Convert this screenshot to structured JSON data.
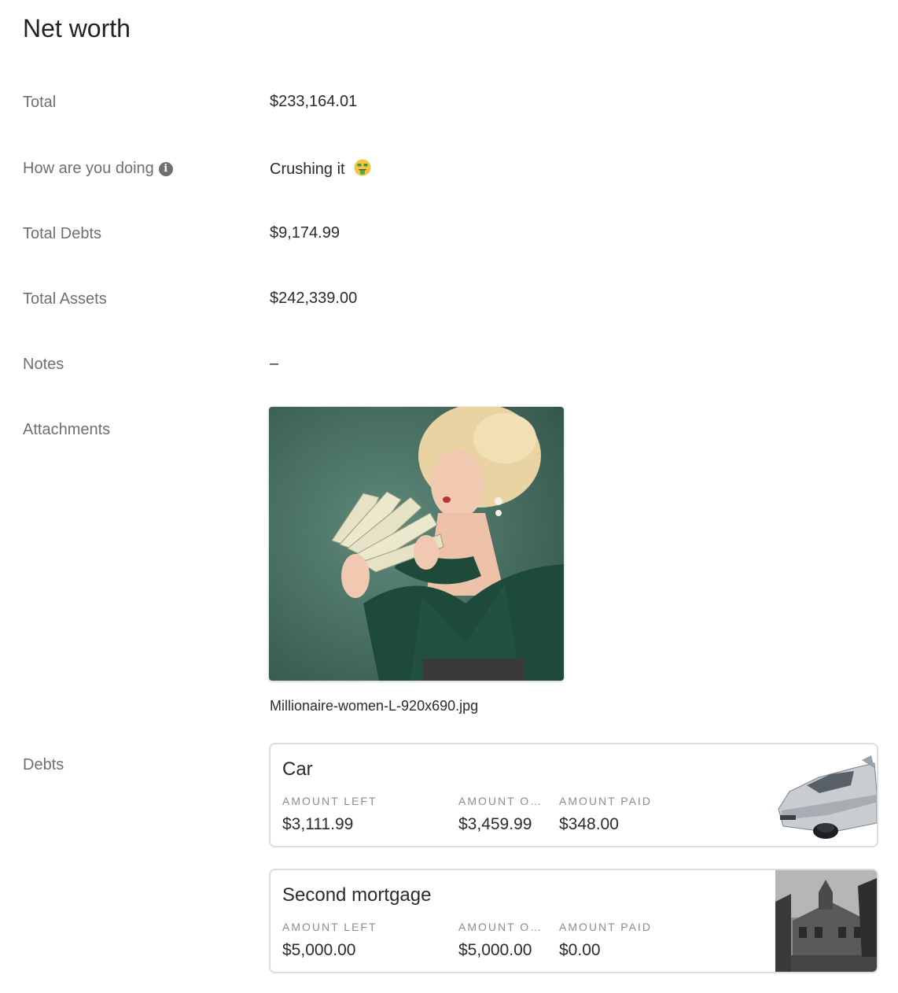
{
  "page": {
    "title": "Net worth"
  },
  "fields": {
    "total": {
      "label": "Total",
      "value": "$233,164.01"
    },
    "how": {
      "label": "How are you doing",
      "value": "Crushing it",
      "emoji": "money-mouth-face-icon"
    },
    "debts_total": {
      "label": "Total Debts",
      "value": "$9,174.99"
    },
    "assets_total": {
      "label": "Total Assets",
      "value": "$242,339.00"
    },
    "notes": {
      "label": "Notes",
      "value": "–"
    },
    "attachments": {
      "label": "Attachments"
    },
    "debts": {
      "label": "Debts"
    }
  },
  "attachment": {
    "filename": "Millionaire-women-L-920x690.jpg"
  },
  "debt_columns": {
    "left": "AMOUNT LEFT",
    "owed": "AMOUNT O…",
    "paid": "AMOUNT PAID"
  },
  "debts": [
    {
      "name": "Car",
      "amount_left": "$3,111.99",
      "amount_owed": "$3,459.99",
      "amount_paid": "$348.00",
      "image": "car-photo"
    },
    {
      "name": "Second mortgage",
      "amount_left": "$5,000.00",
      "amount_owed": "$5,000.00",
      "amount_paid": "$0.00",
      "image": "house-photo"
    }
  ],
  "colors": {
    "label": "#6f6f6f",
    "value": "#2b2b2b",
    "card_border": "#dcdcdc"
  }
}
